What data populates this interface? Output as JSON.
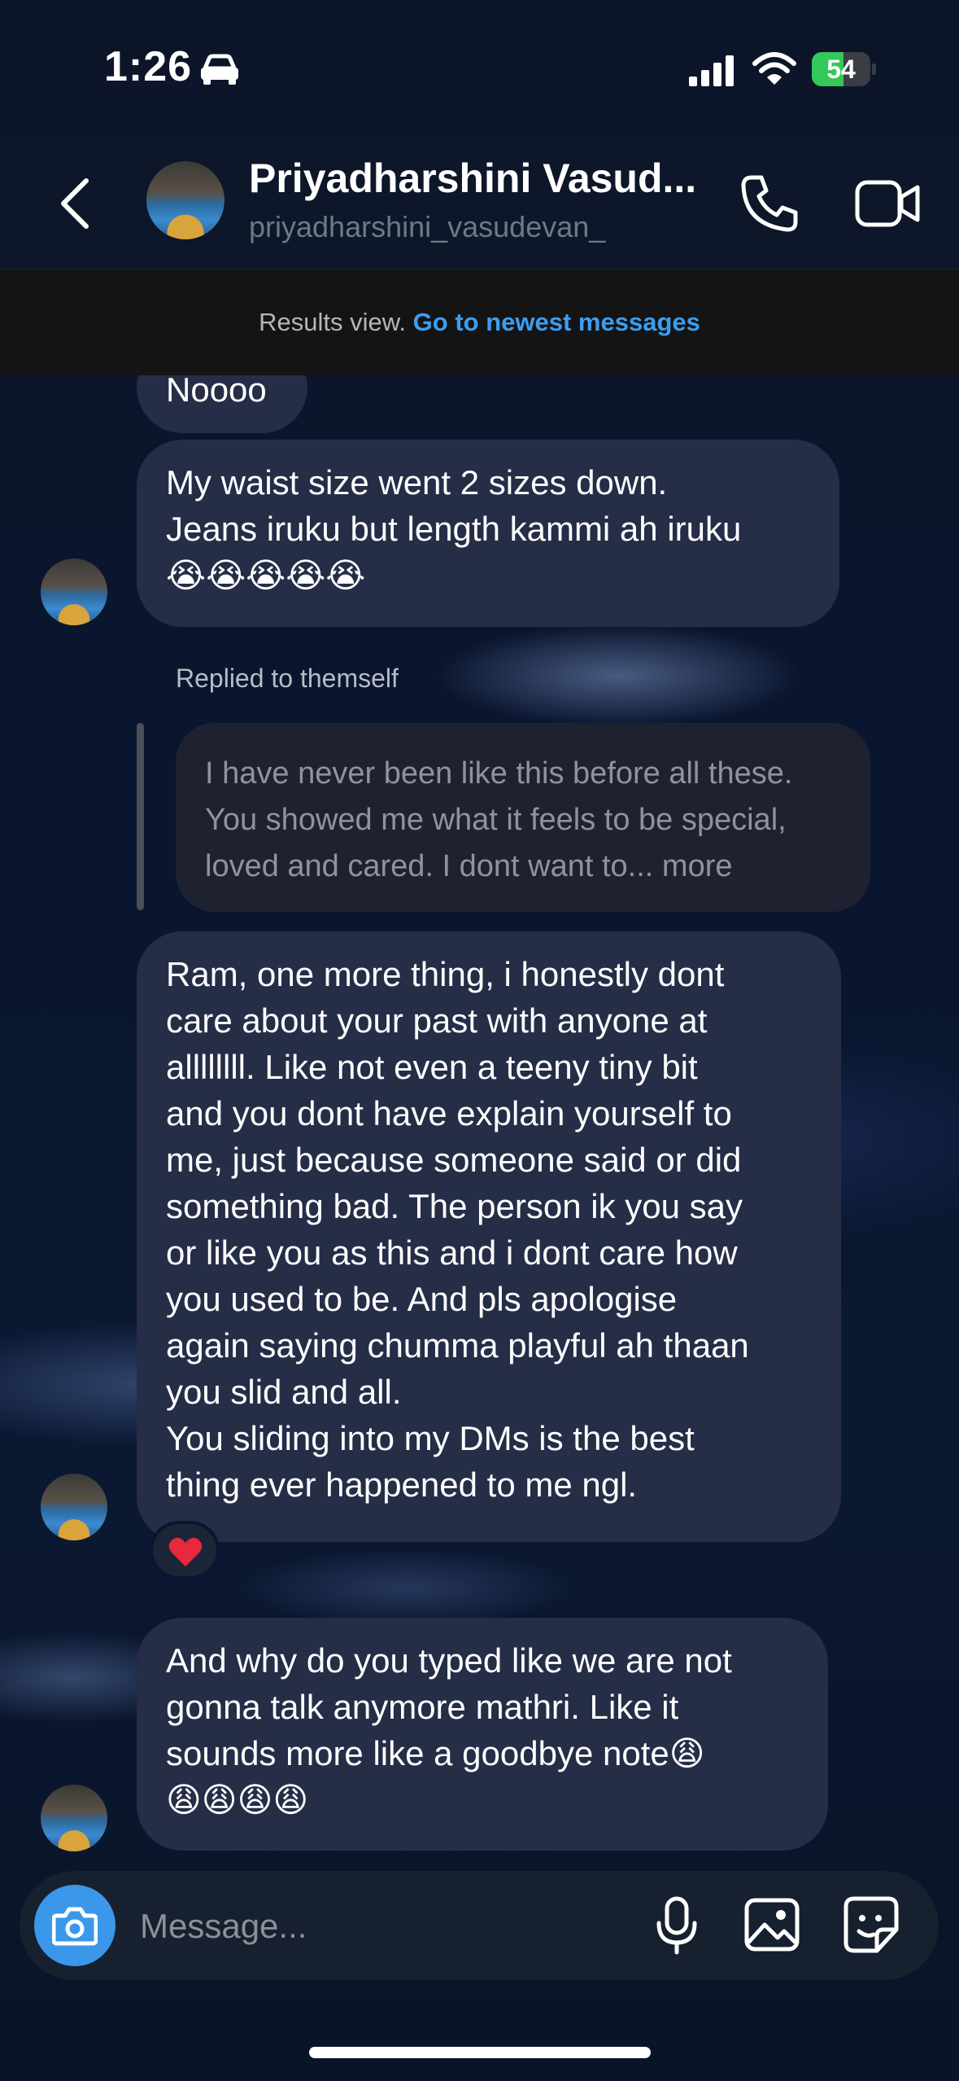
{
  "status_bar": {
    "time": "1:26",
    "battery_level": "54",
    "battery_fraction": 0.54
  },
  "header": {
    "name": "Priyadharshini Vasud...",
    "handle": "priyadharshini_vasudevan_",
    "icons": [
      "back-icon",
      "phone-icon",
      "video-icon"
    ]
  },
  "results_banner": {
    "text": "Results view.",
    "link": "Go to newest messages"
  },
  "messages": [
    {
      "lines": [
        "Noooo"
      ]
    },
    {
      "lines": [
        "My waist size went 2 sizes down.",
        "Jeans iruku but length kammi ah iruku",
        "😭😭😭😭😭"
      ]
    },
    {
      "reply_label": "Replied to themself",
      "quoted_lines": [
        "I have never been like this before all these.",
        "You showed me what it feels to be special,",
        "loved and cared. I dont want to... more"
      ]
    },
    {
      "lines": [
        "Ram, one more thing, i honestly dont",
        "care about your past with anyone at",
        "allllllll. Like not even a teeny tiny bit",
        "and you dont have explain yourself to",
        "me, just because someone said or did",
        "something bad. The person ik you say",
        "or like you as this and i dont care how",
        "you used to be. And pls apologise",
        "again saying chumma playful ah thaan",
        "you slid and all.",
        "You sliding into my DMs is the best",
        "thing ever happened to me ngl."
      ],
      "reaction": "❤️"
    },
    {
      "lines": [
        "And why do you typed like we are not",
        "gonna talk anymore mathri. Like it",
        "sounds more like a goodbye note😩",
        "😩😩😩😩"
      ]
    }
  ],
  "composer": {
    "placeholder": "Message..."
  },
  "colors": {
    "accent": "#3c9ef0",
    "bubble": "#252d47",
    "battery": "#34c759"
  }
}
